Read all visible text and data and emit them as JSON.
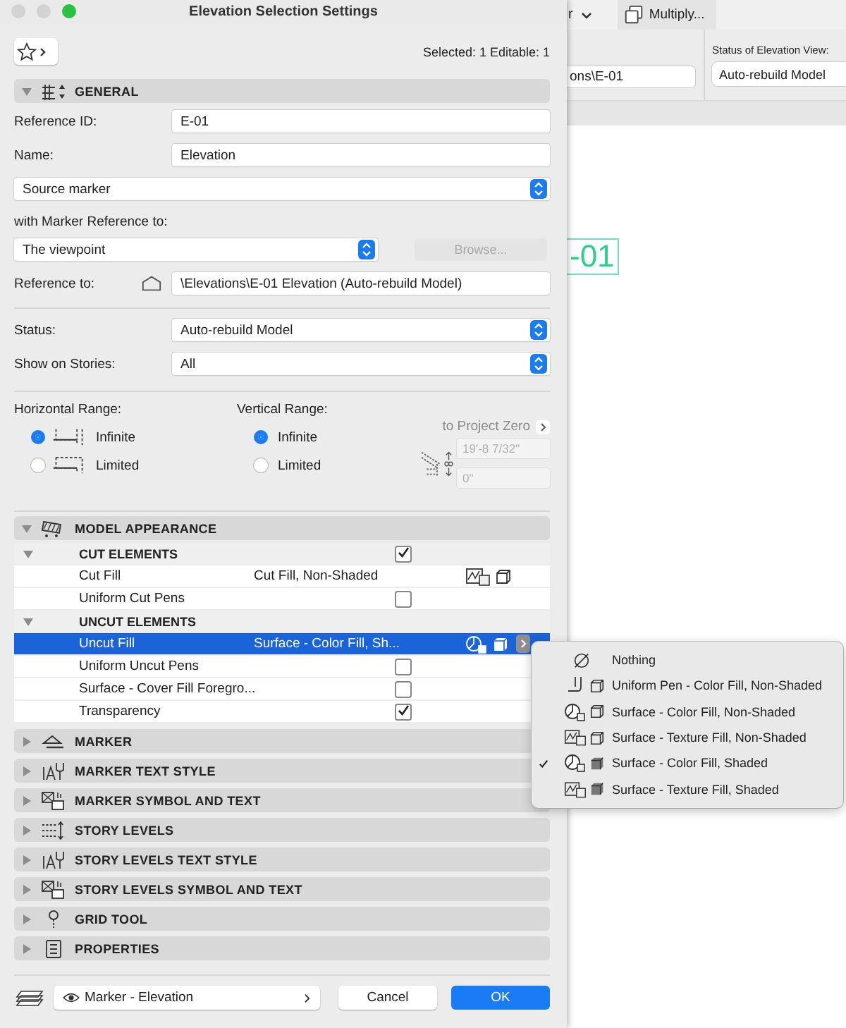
{
  "background_app": {
    "toolbar": {
      "cut_label": "r",
      "multiply_button": "Multiply..."
    },
    "path_field": {
      "value": "ons\\E-01"
    },
    "status_view": {
      "label": "Status of Elevation View:",
      "value": "Auto-rebuild Model"
    },
    "canvas": {
      "marker_label": "-01"
    }
  },
  "window": {
    "title": "Elevation Selection Settings"
  },
  "selection_info": "Selected: 1 Editable: 1",
  "general": {
    "title": "GENERAL",
    "expanded": true,
    "reference_id": {
      "label": "Reference ID:",
      "value": "E-01"
    },
    "name": {
      "label": "Name:",
      "value": "Elevation"
    },
    "marker_type": {
      "value": "Source marker"
    },
    "marker_reference": {
      "label": "with Marker Reference to:",
      "value": "The viewpoint",
      "browse": {
        "label": "Browse...",
        "disabled": true
      }
    },
    "reference_to": {
      "label": "Reference to:",
      "value": "\\Elevations\\E-01 Elevation (Auto-rebuild Model)"
    },
    "status": {
      "label": "Status:",
      "value": "Auto-rebuild Model"
    },
    "show_on_stories": {
      "label": "Show on Stories:",
      "value": "All"
    },
    "horizontal_range": {
      "label": "Horizontal Range:",
      "options": [
        {
          "label": "Infinite",
          "selected": true
        },
        {
          "label": "Limited",
          "selected": false
        }
      ]
    },
    "vertical_range": {
      "label": "Vertical Range:",
      "options": [
        {
          "label": "Infinite",
          "selected": true
        },
        {
          "label": "Limited",
          "selected": false
        }
      ]
    },
    "project_zero": {
      "label": "to Project Zero",
      "top": {
        "value": "19'-8 7/32\"",
        "disabled": true
      },
      "bottom": {
        "value": "0\"",
        "disabled": true
      }
    }
  },
  "model_appearance": {
    "title": "MODEL APPEARANCE",
    "expanded": true,
    "rows": [
      {
        "kind": "group",
        "label": "CUT ELEMENTS",
        "expanded": true,
        "checked": true,
        "selected": false
      },
      {
        "kind": "texture-fill",
        "label": "Cut Fill",
        "value": "Cut Fill, Non-Shaded",
        "selected": false
      },
      {
        "kind": "check",
        "label": "Uniform Cut Pens",
        "checked": false,
        "selected": false
      },
      {
        "kind": "group",
        "label": "UNCUT ELEMENTS",
        "expanded": true,
        "selected": false
      },
      {
        "kind": "color-fill",
        "label": "Uncut Fill",
        "value": "Surface - Color Fill, Sh...",
        "selected": true
      },
      {
        "kind": "check",
        "label": "Uniform Uncut Pens",
        "checked": false,
        "selected": false
      },
      {
        "kind": "check",
        "label": "Surface - Cover Fill Foregro...",
        "checked": false,
        "selected": false
      },
      {
        "kind": "check",
        "label": "Transparency",
        "checked": true,
        "selected": false
      }
    ]
  },
  "collapsed_sections": [
    {
      "title": "MARKER",
      "expanded": false
    },
    {
      "title": "MARKER TEXT STYLE",
      "expanded": false
    },
    {
      "title": "MARKER SYMBOL AND TEXT",
      "expanded": false
    },
    {
      "title": "STORY LEVELS",
      "expanded": false
    },
    {
      "title": "STORY LEVELS TEXT STYLE",
      "expanded": false
    },
    {
      "title": "STORY LEVELS SYMBOL AND TEXT",
      "expanded": false
    },
    {
      "title": "GRID TOOL",
      "expanded": false
    },
    {
      "title": "PROPERTIES",
      "expanded": false
    }
  ],
  "footer": {
    "layer": {
      "value": "Marker - Elevation"
    },
    "cancel": "Cancel",
    "ok": "OK"
  },
  "fill_menu": {
    "items": [
      {
        "label": "Nothing",
        "kind": "nothing",
        "checked": false
      },
      {
        "label": "Uniform Pen - Color Fill, Non-Shaded",
        "kind": "pen-flat",
        "checked": false
      },
      {
        "label": "Surface - Color Fill, Non-Shaded",
        "kind": "color-flat",
        "checked": false
      },
      {
        "label": "Surface - Texture Fill, Non-Shaded",
        "kind": "texture-flat",
        "checked": false
      },
      {
        "label": "Surface - Color Fill, Shaded",
        "kind": "color-shaded",
        "checked": true
      },
      {
        "label": "Surface - Texture Fill, Shaded",
        "kind": "texture-shaded",
        "checked": false
      }
    ]
  }
}
